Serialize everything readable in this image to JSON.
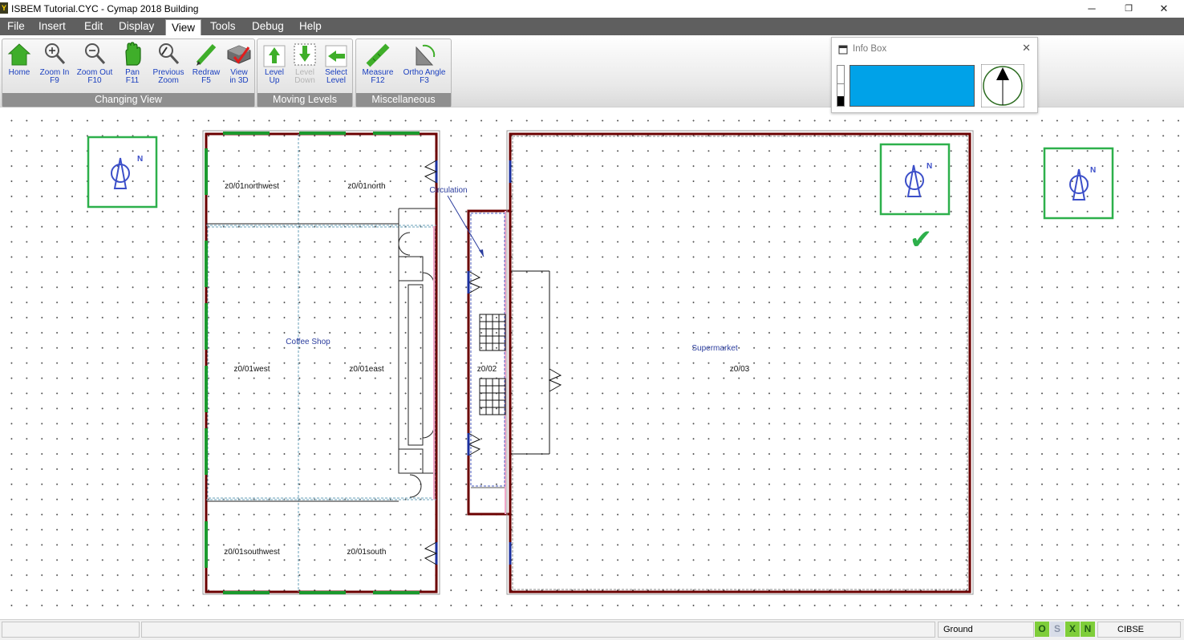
{
  "window": {
    "title": "ISBEM Tutorial.CYC - Cymap 2018 Building",
    "app_icon": "Y",
    "minimize_glyph": "─",
    "restore_glyph": "❐",
    "close_glyph": "✕"
  },
  "menu": [
    "File",
    "Insert",
    "Edit",
    "Display",
    "View",
    "Tools",
    "Debug",
    "Help"
  ],
  "menu_active": "View",
  "ribbon": {
    "groups": {
      "changing_view": "Changing View",
      "moving_levels": "Moving Levels",
      "miscellaneous": "Miscellaneous"
    },
    "buttons": {
      "home": "Home",
      "zoom_in": "Zoom In\nF9",
      "zoom_out": "Zoom Out\nF10",
      "pan": "Pan\nF11",
      "previous_zoom": "Previous\nZoom",
      "redraw": "Redraw\nF5",
      "view_3d": "View\nin 3D",
      "level_up": "Level\nUp",
      "level_down": "Level\nDown",
      "select_level": "Select\nLevel",
      "measure": "Measure\nF12",
      "ortho_angle": "Ortho Angle\nF3"
    }
  },
  "info_box": {
    "title": "Info Box",
    "swatch_color": "#00a2e8",
    "close_glyph": "✕"
  },
  "plan": {
    "north_label": "N",
    "rooms": {
      "northwest": "z0/01northwest",
      "north": "z0/01north",
      "coffee_shop": "Coffee Shop",
      "west": "z0/01west",
      "east": "z0/01east",
      "southwest": "z0/01southwest",
      "south": "z0/01south",
      "circulation": "Circulation",
      "z002": "z0/02",
      "supermarket": "Supermarket",
      "z003": "z0/03"
    },
    "check_glyph": "✔"
  },
  "statusbar": {
    "level": "Ground",
    "flags": [
      "O",
      "S",
      "X",
      "N"
    ],
    "method": "CIBSE"
  },
  "colors": {
    "wall": "#6b0000",
    "window_green": "#1b9a2e",
    "door_blue": "#1b2f9e",
    "north_blue": "#3c4fc9",
    "highlight_green": "#2db04b",
    "pink_partition": "#f0a6c8",
    "zone_dash": "#6aa1b9"
  }
}
